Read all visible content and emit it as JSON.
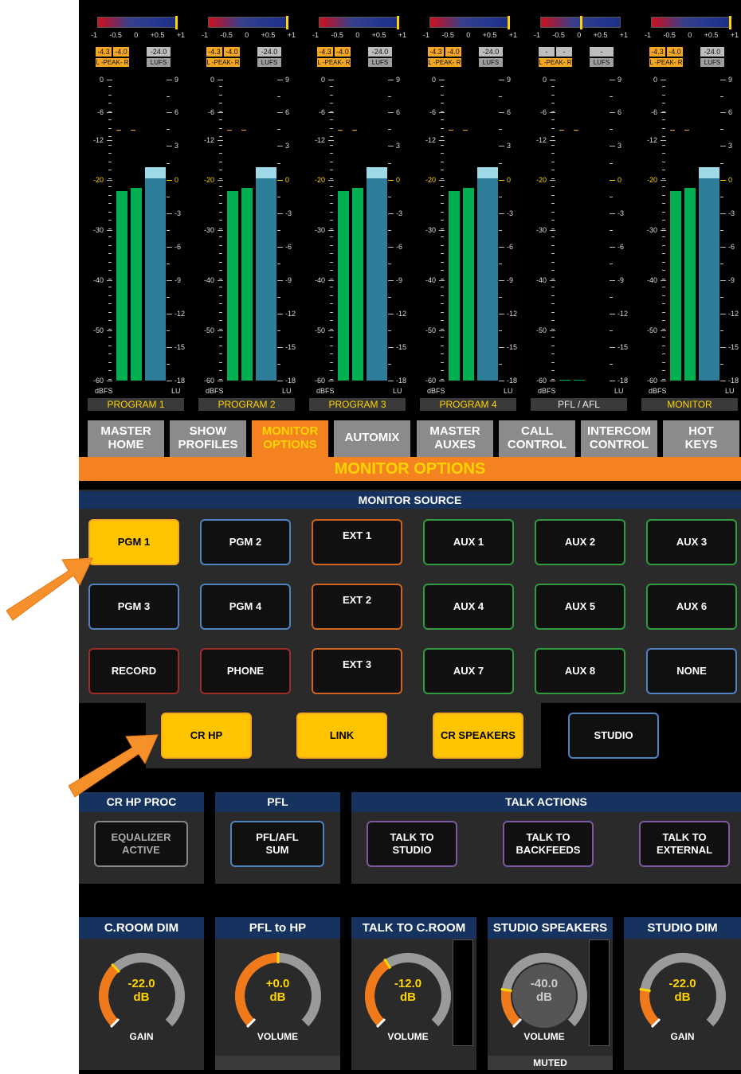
{
  "meters": {
    "top_scale": [
      "-1",
      "-0.5",
      "0",
      "+0.5",
      "+1"
    ],
    "peak_label": "L -PEAK- R",
    "lufs_label": "LUFS",
    "db_scale": [
      "0",
      "-6",
      "-12",
      "-20",
      "-30",
      "-40",
      "-50",
      "-60"
    ],
    "lu_scale": [
      "9",
      "6",
      "3",
      "0",
      "-3",
      "-6",
      "-9",
      "-12",
      "-15",
      "-18"
    ],
    "left_unit": "dBFS",
    "right_unit": "LU",
    "channels": [
      {
        "name": "PROGRAM 1",
        "peak_l": "-4.3",
        "peak_r": "-4.0",
        "lufs": "-24.0",
        "level_l": 0.63,
        "level_r": 0.64,
        "lu_level": 0.71,
        "active": true
      },
      {
        "name": "PROGRAM 2",
        "peak_l": "-4.3",
        "peak_r": "-4.0",
        "lufs": "-24.0",
        "level_l": 0.63,
        "level_r": 0.64,
        "lu_level": 0.71,
        "active": true
      },
      {
        "name": "PROGRAM 3",
        "peak_l": "-4.3",
        "peak_r": "-4.0",
        "lufs": "-24.0",
        "level_l": 0.63,
        "level_r": 0.64,
        "lu_level": 0.71,
        "active": true
      },
      {
        "name": "PROGRAM 4",
        "peak_l": "-4.3",
        "peak_r": "-4.0",
        "lufs": "-24.0",
        "level_l": 0.63,
        "level_r": 0.64,
        "lu_level": 0.71,
        "active": true
      },
      {
        "name": "PFL / AFL",
        "peak_l": "-",
        "peak_r": "-",
        "lufs": "-",
        "level_l": 0.0,
        "level_r": 0.0,
        "lu_level": 0.0,
        "active": false
      },
      {
        "name": "MONITOR",
        "peak_l": "-4.3",
        "peak_r": "-4.0",
        "lufs": "-24.0",
        "level_l": 0.63,
        "level_r": 0.64,
        "lu_level": 0.71,
        "active": true
      }
    ]
  },
  "tabs": [
    {
      "label": "MASTER HOME",
      "line1": "MASTER",
      "line2": "HOME",
      "active": false
    },
    {
      "label": "SHOW PROFILES",
      "line1": "SHOW",
      "line2": "PROFILES",
      "active": false
    },
    {
      "label": "MONITOR OPTIONS",
      "line1": "MONITOR",
      "line2": "OPTIONS",
      "active": true
    },
    {
      "label": "AUTOMIX",
      "line1": "AUTOMIX",
      "line2": "",
      "active": false
    },
    {
      "label": "MASTER AUXES",
      "line1": "MASTER",
      "line2": "AUXES",
      "active": false
    },
    {
      "label": "CALL CONTROL",
      "line1": "CALL",
      "line2": "CONTROL",
      "active": false
    },
    {
      "label": "INTERCOM CONTROL",
      "line1": "INTERCOM",
      "line2": "CONTROL",
      "active": false
    },
    {
      "label": "HOT KEYS",
      "line1": "HOT",
      "line2": "KEYS",
      "active": false
    }
  ],
  "page_title": "MONITOR OPTIONS",
  "monitor_source": {
    "header": "MONITOR SOURCE",
    "buttons": [
      {
        "label": "PGM 1",
        "color": "blue",
        "selected": true
      },
      {
        "label": "PGM 2",
        "color": "blue",
        "selected": false
      },
      {
        "label": "EXT 1",
        "color": "orange",
        "selected": false
      },
      {
        "label": "AUX 1",
        "color": "green",
        "selected": false
      },
      {
        "label": "AUX 2",
        "color": "green",
        "selected": false
      },
      {
        "label": "AUX 3",
        "color": "green",
        "selected": false
      },
      {
        "label": "PGM 3",
        "color": "blue",
        "selected": false
      },
      {
        "label": "PGM 4",
        "color": "blue",
        "selected": false
      },
      {
        "label": "EXT 2",
        "color": "orange",
        "selected": false
      },
      {
        "label": "AUX 4",
        "color": "green",
        "selected": false
      },
      {
        "label": "AUX 5",
        "color": "green",
        "selected": false
      },
      {
        "label": "AUX 6",
        "color": "green",
        "selected": false
      },
      {
        "label": "RECORD",
        "color": "red",
        "selected": false
      },
      {
        "label": "PHONE",
        "color": "red",
        "selected": false
      },
      {
        "label": "EXT 3",
        "color": "orange",
        "selected": false
      },
      {
        "label": "AUX 7",
        "color": "green",
        "selected": false
      },
      {
        "label": "AUX 8",
        "color": "green",
        "selected": false
      },
      {
        "label": "NONE",
        "color": "blue",
        "selected": false
      }
    ]
  },
  "destinations": [
    {
      "label": "CR HP",
      "selected": true
    },
    {
      "label": "LINK",
      "selected": true
    },
    {
      "label": "CR SPEAKERS",
      "selected": true
    },
    {
      "label": "STUDIO",
      "selected": false
    }
  ],
  "cr_hp_proc": {
    "header": "CR HP PROC",
    "button_line1": "EQUALIZER",
    "button_line2": "ACTIVE"
  },
  "pfl": {
    "header": "PFL",
    "button_line1": "PFL/AFL",
    "button_line2": "SUM"
  },
  "talk_actions": {
    "header": "TALK ACTIONS",
    "buttons": [
      {
        "line1": "TALK TO",
        "line2": "STUDIO"
      },
      {
        "line1": "TALK TO",
        "line2": "BACKFEEDS"
      },
      {
        "line1": "TALK TO",
        "line2": "EXTERNAL"
      }
    ]
  },
  "knobs": [
    {
      "title": "C.ROOM DIM",
      "value": "-22.0",
      "unit": "dB",
      "label": "GAIN",
      "fraction": 0.34,
      "muted": false,
      "footer": ""
    },
    {
      "title": "PFL to HP",
      "value": "+0.0",
      "unit": "dB",
      "label": "VOLUME",
      "fraction": 0.5,
      "muted": false,
      "footer": ""
    },
    {
      "title": "TALK TO C.ROOM",
      "value": "-12.0",
      "unit": "dB",
      "label": "VOLUME",
      "fraction": 0.38,
      "muted": false,
      "footer": ""
    },
    {
      "title": "STUDIO SPEAKERS",
      "value": "-40.0",
      "unit": "dB",
      "label": "VOLUME",
      "fraction": 0.2,
      "muted": true,
      "footer": "MUTED"
    },
    {
      "title": "STUDIO DIM",
      "value": "-22.0",
      "unit": "dB",
      "label": "GAIN",
      "fraction": 0.2,
      "muted": false,
      "footer": ""
    }
  ],
  "colors": {
    "accent": "#f58220",
    "selected": "#ffc400",
    "header": "#163360",
    "meter_green": "#00b050",
    "lu_bar": "#2e7e9a"
  }
}
